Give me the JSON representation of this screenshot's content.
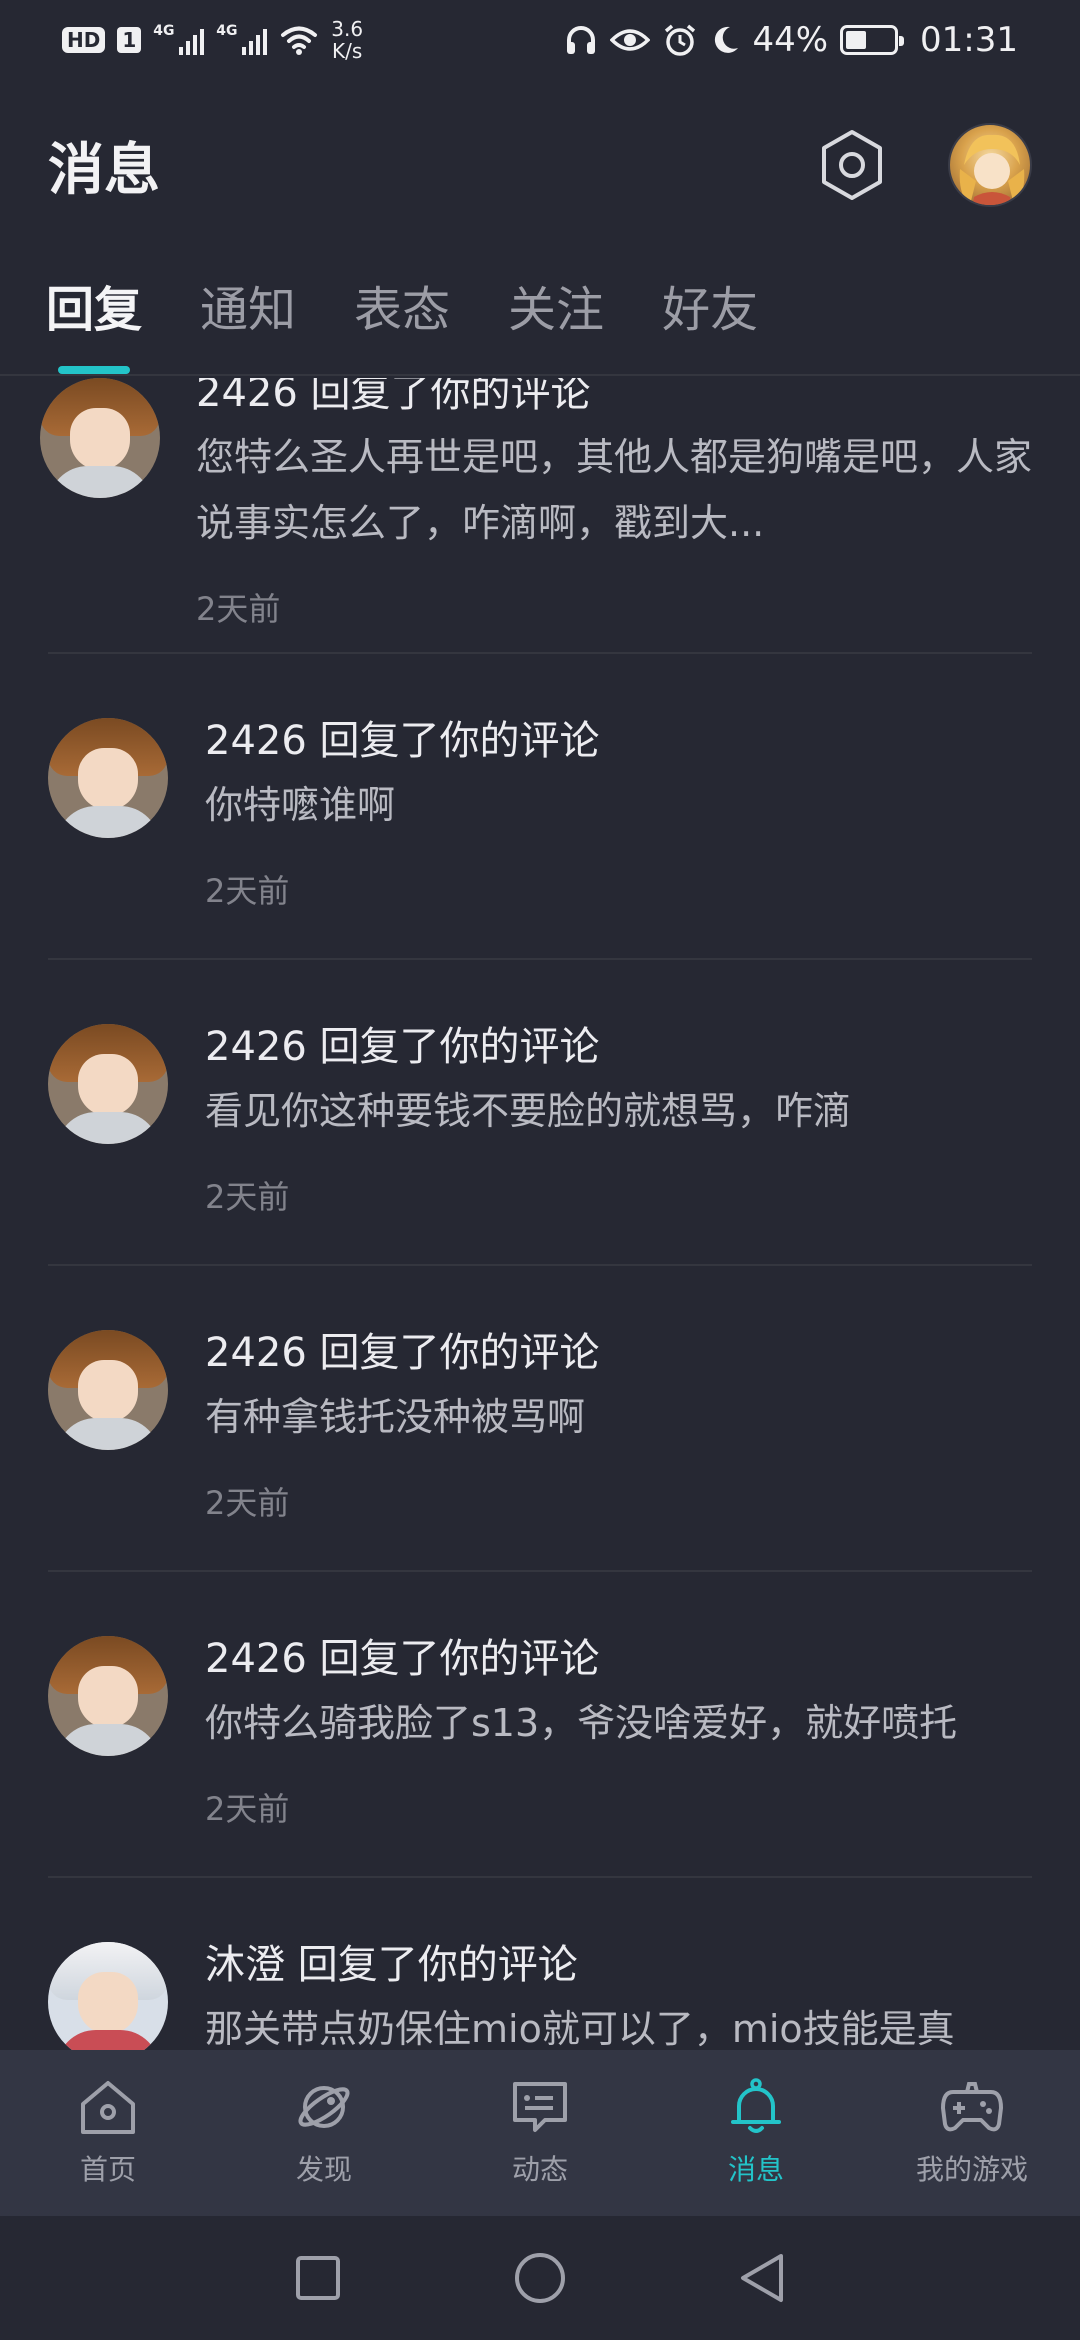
{
  "status_bar": {
    "network_badge": "HD",
    "sim_badge": "1",
    "signal1": "4G",
    "signal2": "4G",
    "speed_value": "3.6",
    "speed_unit": "K/s",
    "battery": "44%",
    "battery_level_percent": 44,
    "time": "01:31",
    "icons": [
      "headphones-icon",
      "eye-icon",
      "alarm-icon",
      "moon-icon"
    ]
  },
  "header": {
    "title": "消息",
    "settings_icon": "gear-hexagon-icon"
  },
  "tabs": [
    {
      "label": "回复",
      "active": true
    },
    {
      "label": "通知",
      "active": false
    },
    {
      "label": "表态",
      "active": false
    },
    {
      "label": "关注",
      "active": false
    },
    {
      "label": "好友",
      "active": false
    }
  ],
  "messages": [
    {
      "title": "2426 回复了你的评论",
      "body": "您特么圣人再世是吧，其他人都是狗嘴是吧，人家说事实怎么了，咋滴啊，戳到大...",
      "time": "2天前"
    },
    {
      "title": "2426 回复了你的评论",
      "body": "你特嚒谁啊",
      "time": "2天前"
    },
    {
      "title": "2426 回复了你的评论",
      "body": "看见你这种要钱不要脸的就想骂，咋滴",
      "time": "2天前"
    },
    {
      "title": "2426 回复了你的评论",
      "body": "有种拿钱托没种被骂啊",
      "time": "2天前"
    },
    {
      "title": "2426 回复了你的评论",
      "body": "你特么骑我脸了s13，爷没啥爱好，就好喷托",
      "time": "2天前"
    },
    {
      "title": "沐澄 回复了你的评论",
      "body": "那关带点奶保住mio就可以了，mio技能是真",
      "time": ""
    }
  ],
  "bottom_nav": [
    {
      "label": "首页",
      "icon": "home-icon",
      "active": false
    },
    {
      "label": "发现",
      "icon": "planet-icon",
      "active": false
    },
    {
      "label": "动态",
      "icon": "chat-bubble-icon",
      "active": false
    },
    {
      "label": "消息",
      "icon": "bell-icon",
      "active": true
    },
    {
      "label": "我的游戏",
      "icon": "gamepad-icon",
      "active": false
    }
  ],
  "colors": {
    "background": "#262833",
    "accent": "#23c4c9",
    "nav_background": "#333644"
  }
}
